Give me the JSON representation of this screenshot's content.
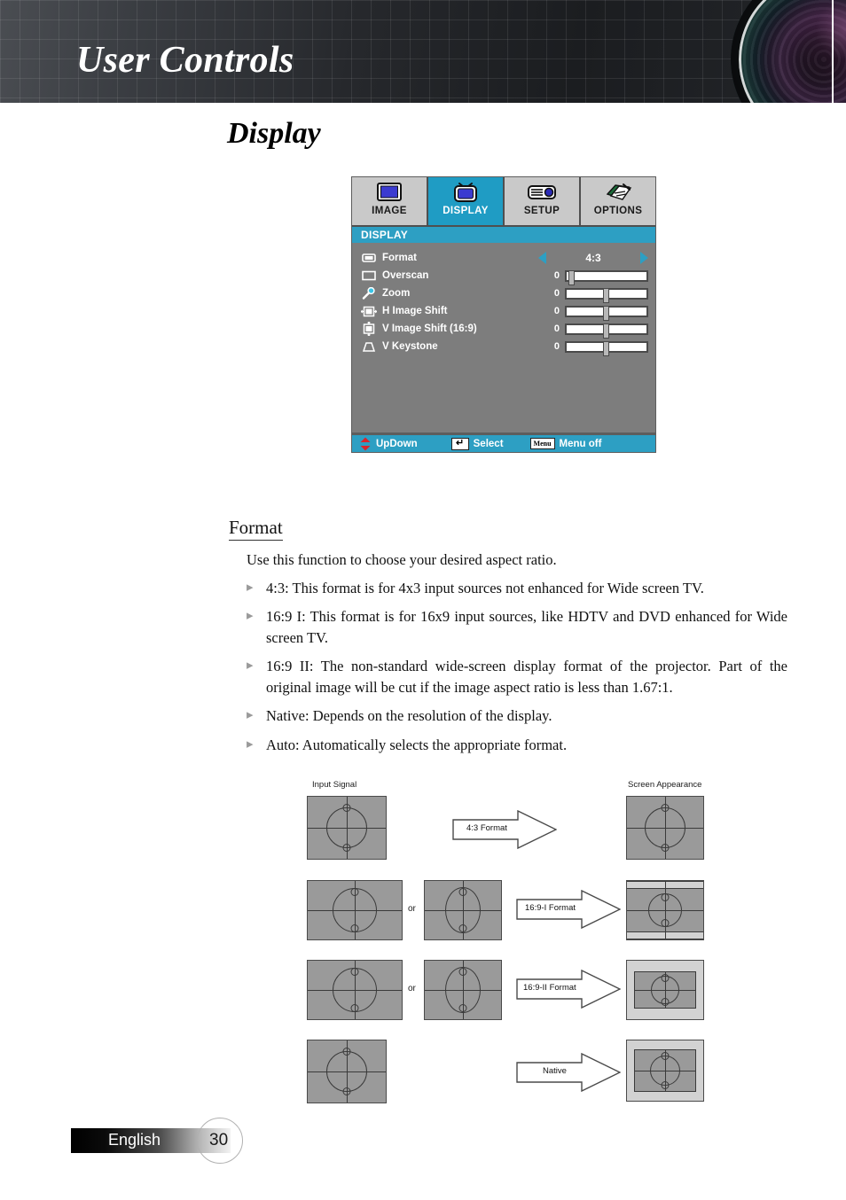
{
  "header": {
    "title": "User Controls",
    "lens_image": "projector-lens-photo"
  },
  "page_title": "Display",
  "osd": {
    "tabs": [
      {
        "label": "IMAGE",
        "icon": "image-screen-icon",
        "active": false
      },
      {
        "label": "DISPLAY",
        "icon": "display-tv-icon",
        "active": true
      },
      {
        "label": "SETUP",
        "icon": "setup-projector-icon",
        "active": false
      },
      {
        "label": "OPTIONS",
        "icon": "options-notepad-pen-icon",
        "active": false
      }
    ],
    "heading": "DISPLAY",
    "rows": [
      {
        "label": "Format",
        "icon": "format-frame-icon",
        "type": "选择",
        "control": "selector",
        "value": "4:3"
      },
      {
        "label": "Overscan",
        "icon": "overscan-rect-icon",
        "control": "slider",
        "value": "0",
        "thumb_pct": 2
      },
      {
        "label": "Zoom",
        "icon": "zoom-magnifier-icon",
        "control": "slider",
        "value": "0",
        "thumb_pct": 50
      },
      {
        "label": "H Image Shift",
        "icon": "h-image-shift-icon",
        "control": "slider",
        "value": "0",
        "thumb_pct": 50
      },
      {
        "label": "V Image Shift (16:9)",
        "icon": "v-image-shift-icon",
        "control": "slider",
        "value": "0",
        "thumb_pct": 50
      },
      {
        "label": "V Keystone",
        "icon": "v-keystone-trapezoid-icon",
        "control": "slider",
        "value": "0",
        "thumb_pct": 50
      }
    ],
    "footer": {
      "updown": "UpDown",
      "select": "Select",
      "menu_off": "Menu off",
      "menu_key_label": "Menu"
    },
    "colors": {
      "accent": "#2d9fc3",
      "panel": "#7d7d7d",
      "tab_inactive": "#c9c9c9"
    }
  },
  "content": {
    "section_heading": "Format",
    "intro": "Use this function to choose your desired aspect ratio.",
    "bullets": [
      "4:3: This format is for 4x3 input sources not enhanced for Wide screen TV.",
      "16:9 I: This format is for 16x9 input sources, like HDTV and DVD enhanced for Wide screen TV.",
      "16:9 II: The non-standard wide-screen display format of the projector. Part of the original image will be cut if the image aspect ratio is less than 1.67:1.",
      "Native: Depends on the resolution of the display.",
      "Auto: Automatically selects the appropriate format."
    ]
  },
  "diagram": {
    "input_label": "Input Signal",
    "output_label": "Screen Appearance",
    "or_label": "or",
    "rows": [
      {
        "arrow_caption": "4:3 Format"
      },
      {
        "arrow_caption": "16:9-I Format"
      },
      {
        "arrow_caption": "16:9-II Format"
      },
      {
        "arrow_caption": "Native"
      }
    ]
  },
  "page_footer": {
    "language": "English",
    "page_number": "30"
  }
}
